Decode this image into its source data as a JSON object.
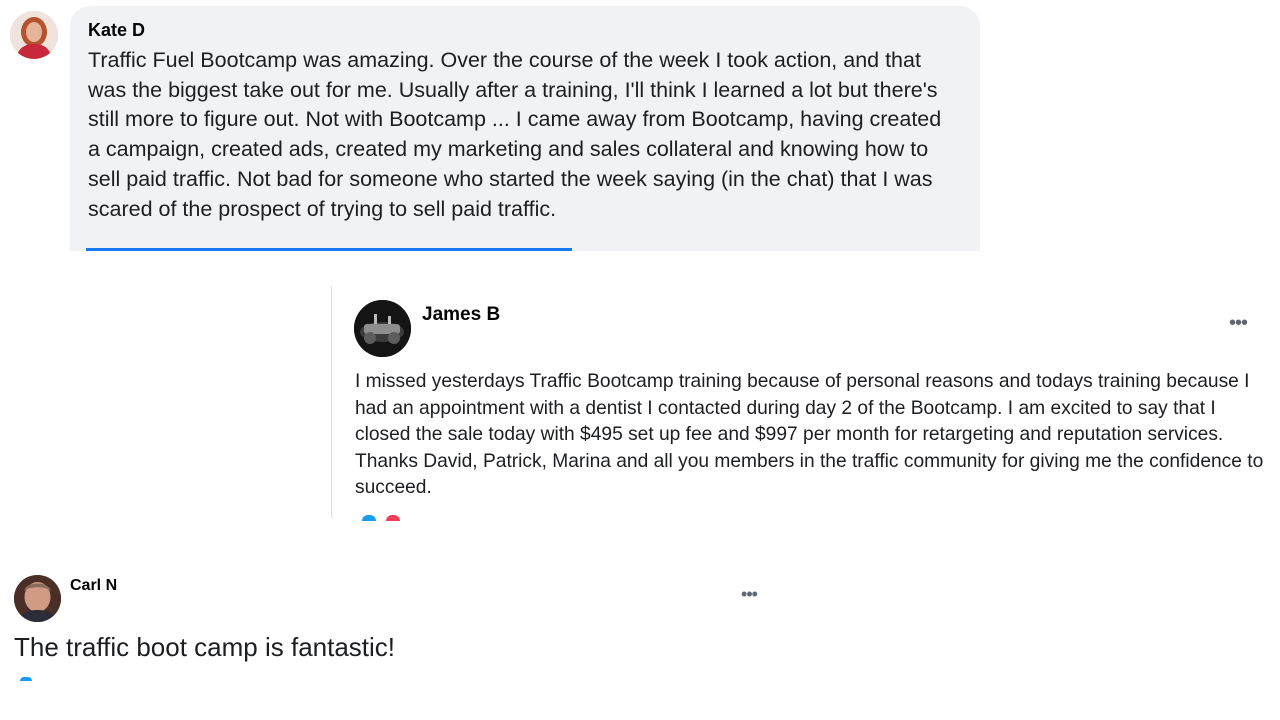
{
  "comments": [
    {
      "author": "Kate D",
      "text": "Traffic Fuel Bootcamp was amazing. Over the course of the week I took action, and that was the biggest take out for me. Usually after a training, I'll think I learned a lot but there's still more to figure out. Not with Bootcamp ... I came away from Bootcamp, having created a campaign, created ads, created my marketing and sales collateral and knowing how to sell paid traffic. Not bad for someone who started the week saying (in the chat) that I was scared of the prospect of trying to sell paid traffic."
    },
    {
      "author": "James B",
      "more_label": "•••",
      "text": "I missed yesterdays Traffic Bootcamp training because of personal reasons and todays training because I had an appointment with a dentist I contacted during day 2 of the Bootcamp. I am excited to say that I closed the sale today with $495 set up fee and $997 per month for retargeting and reputation services. Thanks David, Patrick, Marina and all you members in the traffic community for giving me the confidence to succeed."
    },
    {
      "author": "Carl N",
      "more_label": "•••",
      "text": "The traffic boot camp is fantastic!"
    }
  ],
  "colors": {
    "bubble_bg": "#f0f2f5",
    "link_blue": "#1877f2",
    "reaction_like": "#1b9bf0",
    "reaction_love": "#f33e58"
  }
}
